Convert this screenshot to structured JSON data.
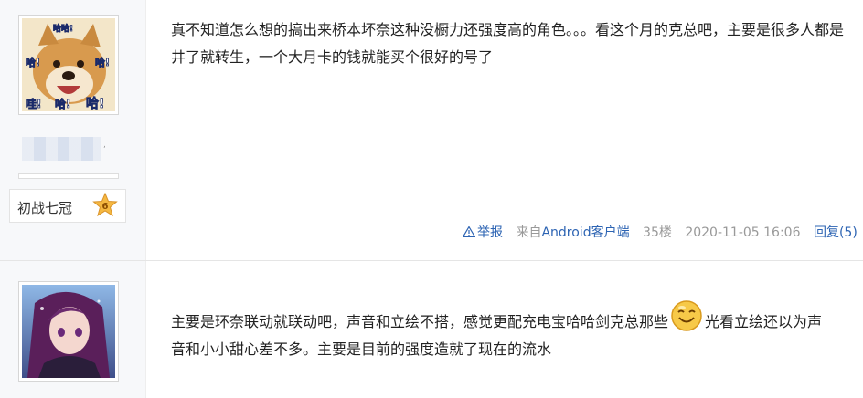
{
  "posts": [
    {
      "user": {
        "avatar_overlay": [
          "哈哈!",
          "哈!",
          "哈!",
          "哇!",
          "哈!",
          "哈!"
        ],
        "badge_title": "初战七冠",
        "badge_level": "6"
      },
      "content": "真不知道怎么想的搞出来桥本坏奈这种没橱力还强度高的角色。。。看这个月的克总吧，主要是很多人都是井了就转生，一个大月卡的钱就能买个很好的号了",
      "meta": {
        "report": "举报",
        "source_prefix": "来自",
        "source_client": "Android客户端",
        "floor": "35楼",
        "time": "2020-11-05 16:06",
        "reply": "回复(5)"
      }
    },
    {
      "content_before_emoji": "主要是环奈联动就联动吧，声音和立绘不搭，感觉更配充电宝哈哈剑克总那些",
      "emoji": "smile-emoji-icon",
      "content_after_emoji": "光看立绘还以为声音和小小甜心差不多。主要是目前的强度造就了现在的流水"
    }
  ],
  "colors": {
    "link": "#2d64b3",
    "meta_gray": "#999999",
    "sidebar_bg": "#f7f8fa",
    "badge_star": "#f5b841"
  }
}
